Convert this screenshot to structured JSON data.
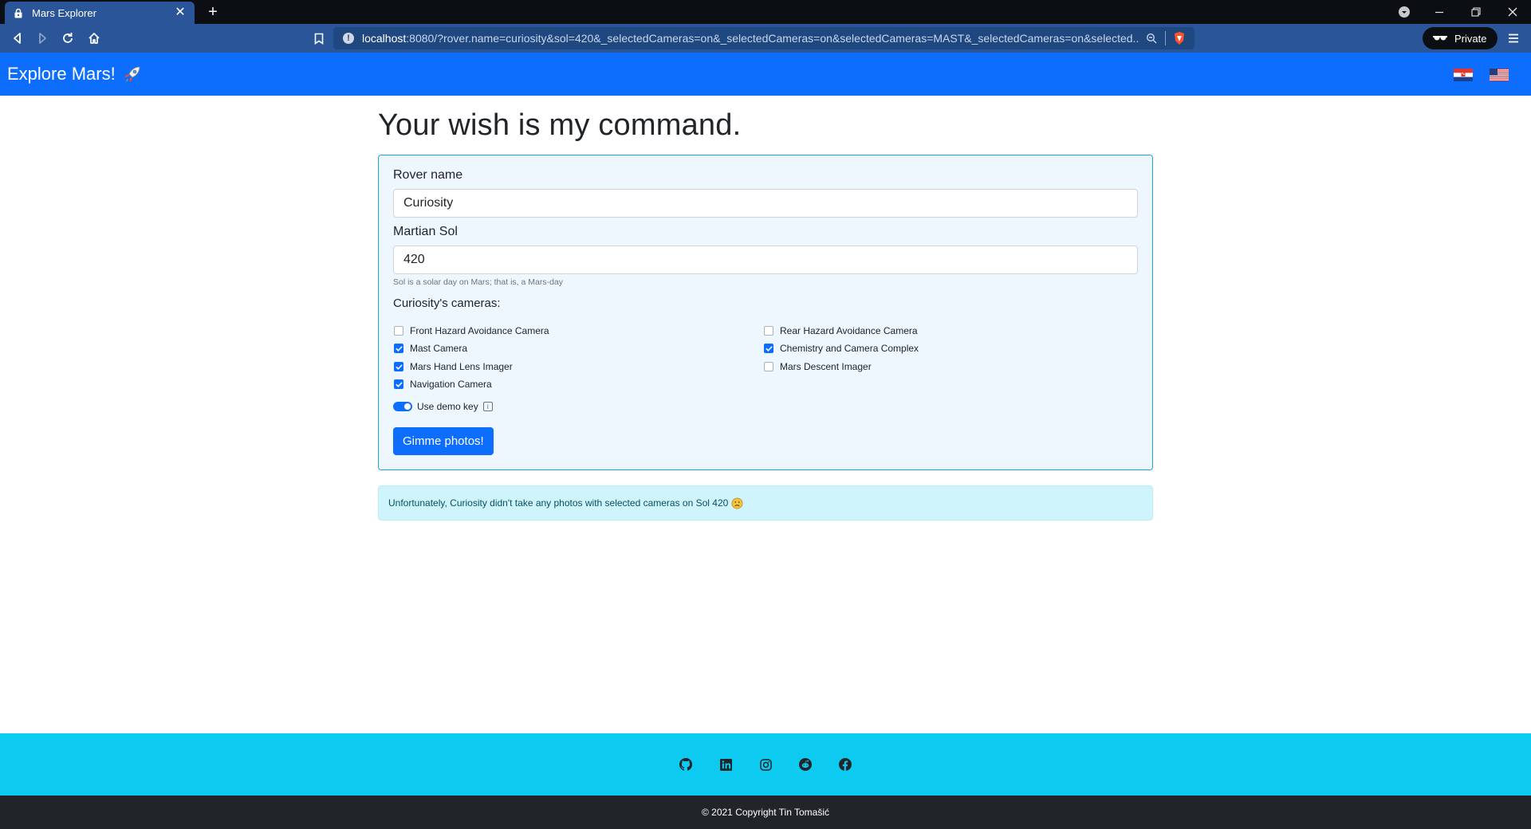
{
  "browser": {
    "tab_title": "Mars Explorer",
    "url_host": "localhost",
    "url_rest": ":8080/?rover.name=curiosity&sol=420&_selectedCameras=on&_selectedCameras=on&selectedCameras=MAST&_selectedCameras=on&selected...",
    "private_label": "Private"
  },
  "navbar": {
    "brand": "Explore Mars!",
    "brand_icon": "rocket-icon",
    "flags": [
      "croatia-flag-icon",
      "usa-flag-icon"
    ]
  },
  "main": {
    "heading": "Your wish is my command.",
    "form": {
      "rover_label": "Rover name",
      "rover_value": "Curiosity",
      "sol_label": "Martian Sol",
      "sol_value": "420",
      "sol_help": "Sol is a solar day on Mars; that is, a Mars-day",
      "cameras_title": "Curiosity's cameras:",
      "cameras": [
        {
          "label": "Front Hazard Avoidance Camera",
          "checked": false
        },
        {
          "label": "Rear Hazard Avoidance Camera",
          "checked": false
        },
        {
          "label": "Mast Camera",
          "checked": true
        },
        {
          "label": "Chemistry and Camera Complex",
          "checked": true
        },
        {
          "label": "Mars Hand Lens Imager",
          "checked": true
        },
        {
          "label": "Mars Descent Imager",
          "checked": false
        },
        {
          "label": "Navigation Camera",
          "checked": true
        }
      ],
      "demo_key_label": "Use demo key",
      "demo_key_on": true,
      "submit_label": "Gimme photos!"
    },
    "alert": "Unfortunately, Curiosity didn't take any photos with selected cameras on Sol 420"
  },
  "footer": {
    "social_icons": [
      "github-icon",
      "linkedin-icon",
      "instagram-icon",
      "reddit-icon",
      "facebook-icon"
    ],
    "copyright": "© 2021 Copyright Tin Tomašić"
  },
  "colors": {
    "primary": "#0d6efd",
    "footer_top": "#0dcaf0",
    "footer_bottom": "#212529",
    "alert_bg": "#cff4fc",
    "card_border": "#1aa6d8"
  }
}
